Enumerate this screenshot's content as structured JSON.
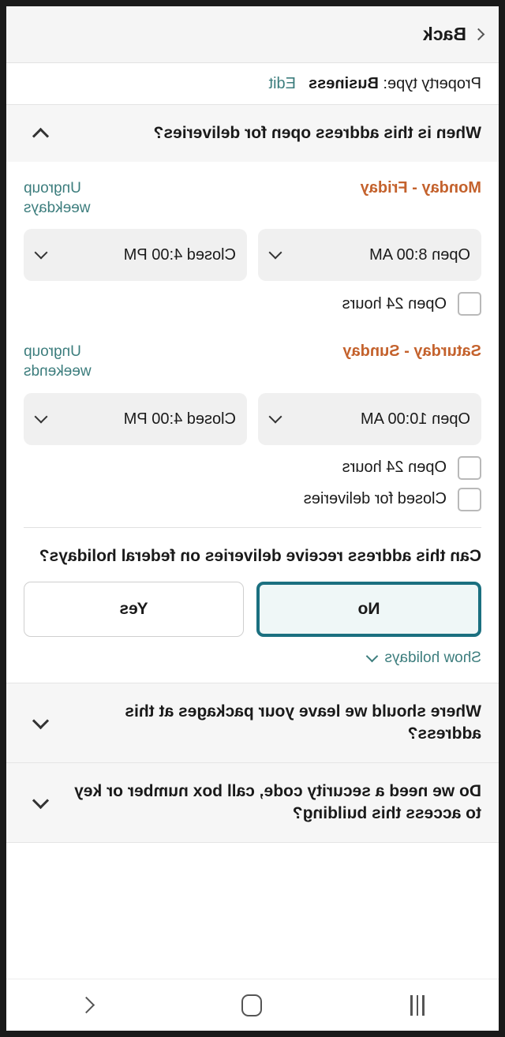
{
  "topbar": {
    "back_label": "Back",
    "back_icon": "chevron-left-icon"
  },
  "property": {
    "prefix": "Property type:",
    "value": "Business",
    "edit_label": "Edit"
  },
  "sections": [
    {
      "id": "delivery-hours",
      "title": "When is this address open for deliveries?",
      "expanded": true,
      "chevron": "chevron-up-icon"
    },
    {
      "id": "package-location",
      "title": "Where should we leave your packages at this address?",
      "expanded": false,
      "chevron": "chevron-down-icon"
    },
    {
      "id": "building-access",
      "title": "Do we need a security code, call box number or key to access this building?",
      "expanded": false,
      "chevron": "chevron-down-icon"
    }
  ],
  "weekday_group": {
    "day_label": "Monday - Friday",
    "ungroup_label": "Ungroup weekdays",
    "open_value": "Open 8:00 AM",
    "close_value": "Closed 4:00 PM",
    "open_24_label": "Open 24 hours",
    "open_24_checked": false
  },
  "weekend_group": {
    "day_label": "Saturday - Sunday",
    "ungroup_label": "Ungroup weekends",
    "open_value": "Open 10:00 AM",
    "close_value": "Closed 4:00 PM",
    "open_24_label": "Open 24 hours",
    "open_24_checked": false,
    "closed_label": "Closed for deliveries",
    "closed_checked": false
  },
  "holidays": {
    "question": "Can this address receive deliveries on federal holidays?",
    "yes_label": "Yes",
    "no_label": "No",
    "selected": "No",
    "show_holidays_label": "Show holidays",
    "show_holidays_icon": "chevron-down-icon"
  },
  "navbar": {
    "recents_icon": "recents-icon",
    "home_icon": "home-icon",
    "back_icon": "nav-back-icon"
  },
  "colors": {
    "accent_teal": "#3c7d7d",
    "selected_border": "#1b7080",
    "selected_bg": "#eff7f7",
    "day_orange": "#c4622d",
    "select_bg": "#f0f0f0",
    "header_bg": "#f6f6f6"
  }
}
